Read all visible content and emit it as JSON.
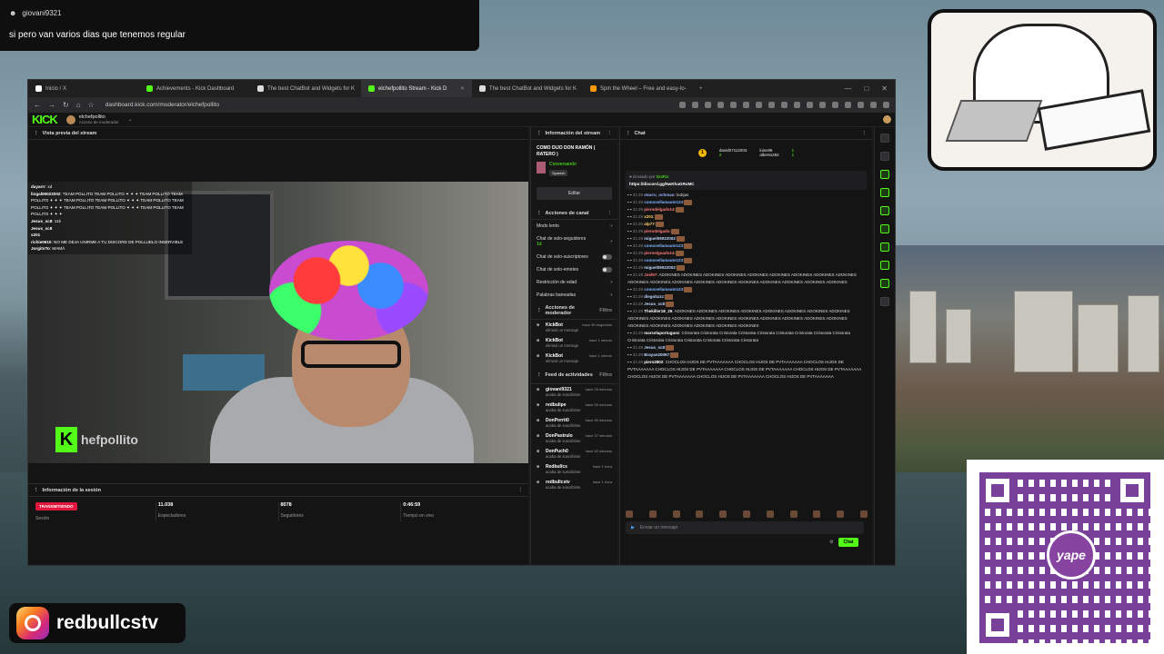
{
  "notification": {
    "user": "giovani9321",
    "message": "si pero van varios dias que tenemos regular"
  },
  "instagram": {
    "handle": "redbullcstv"
  },
  "qr": {
    "brand": "yape"
  },
  "browser": {
    "tabs": [
      {
        "label": "Inicio / X",
        "color": "#000000"
      },
      {
        "label": "Achievements - Kick Dashboard",
        "color": "#53fc18"
      },
      {
        "label": "The best ChatBot and Widgets for K",
        "color": "#ffffff"
      },
      {
        "label": "elchefpollito Stream - Kick D",
        "color": "#53fc18"
      },
      {
        "label": "The best ChatBot and Widgets for K",
        "color": "#ffffff"
      },
      {
        "label": "Spin the Wheel – Free and easy-to-",
        "color": "#ff9900"
      }
    ],
    "url": "dashboard.kick.com/moderator/elchefpollito"
  },
  "kick": {
    "logo": "KICK",
    "channel": "elchefpollito",
    "role": "Acceso de moderador"
  },
  "preview": {
    "title": "Vista previa del stream",
    "watermark": "hefpollito",
    "overlay": [
      {
        "u": "dayarrr",
        "t": ": xd"
      },
      {
        "u": "lingal09022002",
        "t": ": TEAM POLLITO TEAM POLLITO ✦ ✦ ✦ TEAM POLLITO TEAM POLLITO ✦ ✦ ✦ TEAM POLLITO TEAM POLLITO ✦ ✦ ✦ TEAM POLLITO TEAM POLLITO ✦ ✦ ✦ TEAM POLLITO TEAM POLLITO ✦ ✦ ✦ TEAM POLLITO TEAM POLLITO ✦ ✦ ✦"
      },
      {
        "u": "Jesus_sc8",
        "t": ": 11k"
      },
      {
        "u": "Jesus_sc8",
        "t": ""
      },
      {
        "u": "x201",
        "t": ""
      },
      {
        "u": "richie0610",
        "t": ": NO ME DEJA UNIRME A TU DISCORD DE POLLUELO INSERVIBLE"
      },
      {
        "u": "JorgitoTo",
        "t": ": MAMÁ"
      }
    ]
  },
  "session": {
    "title": "Información de la sesión",
    "stats": [
      {
        "value": "TRANSMITIENDO",
        "label": "Sesión"
      },
      {
        "value": "11.038",
        "label": "Espectadores"
      },
      {
        "value": "8078",
        "label": "Seguidores"
      },
      {
        "value": "0:46:59",
        "label": "Tiempo en vivo"
      }
    ]
  },
  "streamInfo": {
    "header": "Información del stream",
    "title": "COMO DIJO DON RAMÓN ( RATERO )",
    "category": "Conversando",
    "tag": "Spanish",
    "edit": "Editar"
  },
  "channelActions": {
    "header": "Acciones de canal",
    "options": [
      {
        "label": "Modo lento",
        "kind": "arrow"
      },
      {
        "label": "Chat de solo-seguidores",
        "sub": "1d",
        "kind": "arrow"
      },
      {
        "label": "Chat de solo-suscriptores",
        "kind": "toggle"
      },
      {
        "label": "Chat de solo-emotes",
        "kind": "toggle"
      },
      {
        "label": "Restricción de edad",
        "kind": "arrow"
      },
      {
        "label": "Palabras baneadas",
        "kind": "arrow"
      }
    ]
  },
  "modActions": {
    "header": "Acciones de moderador",
    "filter": "Filtro",
    "items": [
      {
        "name": "KickBot",
        "sub": "eliminó un mensaje",
        "time": "hace 49 segundos"
      },
      {
        "name": "KickBot",
        "sub": "eliminó un mensaje",
        "time": "hace 1 minuto"
      },
      {
        "name": "KickBot",
        "sub": "eliminó un mensaje",
        "time": "hace 1 minuto"
      }
    ]
  },
  "activity": {
    "header": "Feed de actividades",
    "filter": "Filtro",
    "items": [
      {
        "name": "giovani9321",
        "sub": "acaba de suscribirse",
        "time": "hace 25 minutos"
      },
      {
        "name": "redbulipe",
        "sub": "acaba de suscribirse",
        "time": "hace 28 minutos"
      },
      {
        "name": "DonPorrit0",
        "sub": "acaba de suscribirse",
        "time": "hace 30 minutos"
      },
      {
        "name": "DonPastrulo",
        "sub": "acaba de suscribirse",
        "time": "hace 37 minutos"
      },
      {
        "name": "DonPuch0",
        "sub": "acaba de suscribirse",
        "time": "hace 40 minutos"
      },
      {
        "name": "Redbullcs",
        "sub": "acaba de suscribirse",
        "time": "hace 1 hora"
      },
      {
        "name": "redbullcstv",
        "sub": "acaba de suscribirse",
        "time": "hace 1 hora"
      }
    ]
  },
  "chat": {
    "header": "Chat",
    "top": [
      {
        "name": "david07112003",
        "count": "1"
      },
      {
        "name": "luisv95",
        "count": "1"
      },
      {
        "name": "alberto282",
        "count": "1"
      }
    ],
    "topRank": "1",
    "topCount2": "2",
    "pinned": {
      "by": "Enviado por",
      "user": "BotRix",
      "link": "https://discord.gg/5wKhaGRcMC"
    },
    "messages": [
      {
        "ts": "21:29",
        "u": "stacru_ochmao",
        "t": ": bobjas",
        "c": "#9fb1ff"
      },
      {
        "ts": "21:29",
        "u": "comosellamaute123",
        "t": ":",
        "c": "#7fb3ff"
      },
      {
        "ts": "21:29",
        "u": "pierodelgado14",
        "t": ":",
        "c": "#ff7a7a"
      },
      {
        "ts": "21:29",
        "u": "x201",
        "t": ":",
        "c": "#ffd36b"
      },
      {
        "ts": "21:29",
        "u": "alp77",
        "t": ":",
        "c": "#ffd36b"
      },
      {
        "ts": "21:29",
        "u": "pierodelgado",
        "t": ":",
        "c": "#ff7a7a"
      },
      {
        "ts": "21:29",
        "u": "miguel09022002",
        "t": ":",
        "c": "#c0d8ff"
      },
      {
        "ts": "21:29",
        "u": "comosellamaute123",
        "t": ":",
        "c": "#7fb3ff"
      },
      {
        "ts": "21:29",
        "u": "pieroelguado14",
        "t": ":",
        "c": "#ff7a7a"
      },
      {
        "ts": "21:29",
        "u": "comosellamaute123",
        "t": ":",
        "c": "#7fb3ff"
      },
      {
        "ts": "21:29",
        "u": "miguel09022002",
        "t": ":",
        "c": "#c0d8ff"
      },
      {
        "ts": "21:29",
        "u": "Joel57",
        "t": ": ADOKINES ADOKINES ADOKINES ADOKINES ADOKINES ADOKINES ADOKINES ADOKINES ADOKINES ADOKINES ADOKINES ADOKINES ADOKINES ADOKINES ADOKINES ADOKINES ADOKINES ADOKINES ADOKINES",
        "c": "#ff7a7a"
      },
      {
        "ts": "21:29",
        "u": "comosellamaute123",
        "t": ":",
        "c": "#7fb3ff"
      },
      {
        "ts": "21:29",
        "u": "diegobzzc",
        "t": ":",
        "c": "#c0d8ff"
      },
      {
        "ts": "21:29",
        "u": "Jesus_sc8",
        "t": ":",
        "c": "#c0d8ff"
      },
      {
        "ts": "21:29",
        "u": "Thekiller18_25",
        "t": ": ADOKINES ADOKINES ADOKINES ADOKINES ADOKINES ADOKINES ADOKINES ADOKINES ADOKINES ADOKINES ADOKINES ADOKINES ADOKINES ADOKINES ADOKINES ADOKINES ADOKINES ADOKINES ADOKINES ADOKINES ADOKINES ADOKINES ADOKINES ADOKINES",
        "c": "#ffffff"
      },
      {
        "ts": "21:29",
        "u": "marcelaportuguez",
        "t": ": Cristorata Cristorata Cristorata Cristorata Cristorata Cristorata Cristorata Cristorata Cristorata Cristorata Cristorata Cristorata Cristorata Cristorata Cristorata Cristorata",
        "c": "#ffffff"
      },
      {
        "ts": "21:29",
        "u": "Jesus_sc8",
        "t": ":",
        "c": "#c0d8ff"
      },
      {
        "ts": "21:29",
        "u": "Brayan20067",
        "t": ":",
        "c": "#c0d8ff"
      },
      {
        "ts": "21:29",
        "u": "piero2802",
        "t": ": CHOCLOS HIJOS DE PVTAAAAAAA CHOCLOS HIJOS DE PVTAAAAAAA CHOCLOS HIJOS DE PVTAAAAAAA CHOCLOS HIJOS DE PVTAAAAAAA CHOCLOS HIJOS DE PVTAAAAAAA CHOCLOS HIJOS DE PVTAAAAAAA CHOCLOS HIJOS DE PVTAAAAAAA CHOCLOS HIJOS DE PVTAAAAAAA CHOCLOS HIJOS DE PVTAAAAAAA",
        "c": "#ffffff"
      }
    ],
    "placeholder": "Enviar un mensaje",
    "send": "Chat"
  }
}
